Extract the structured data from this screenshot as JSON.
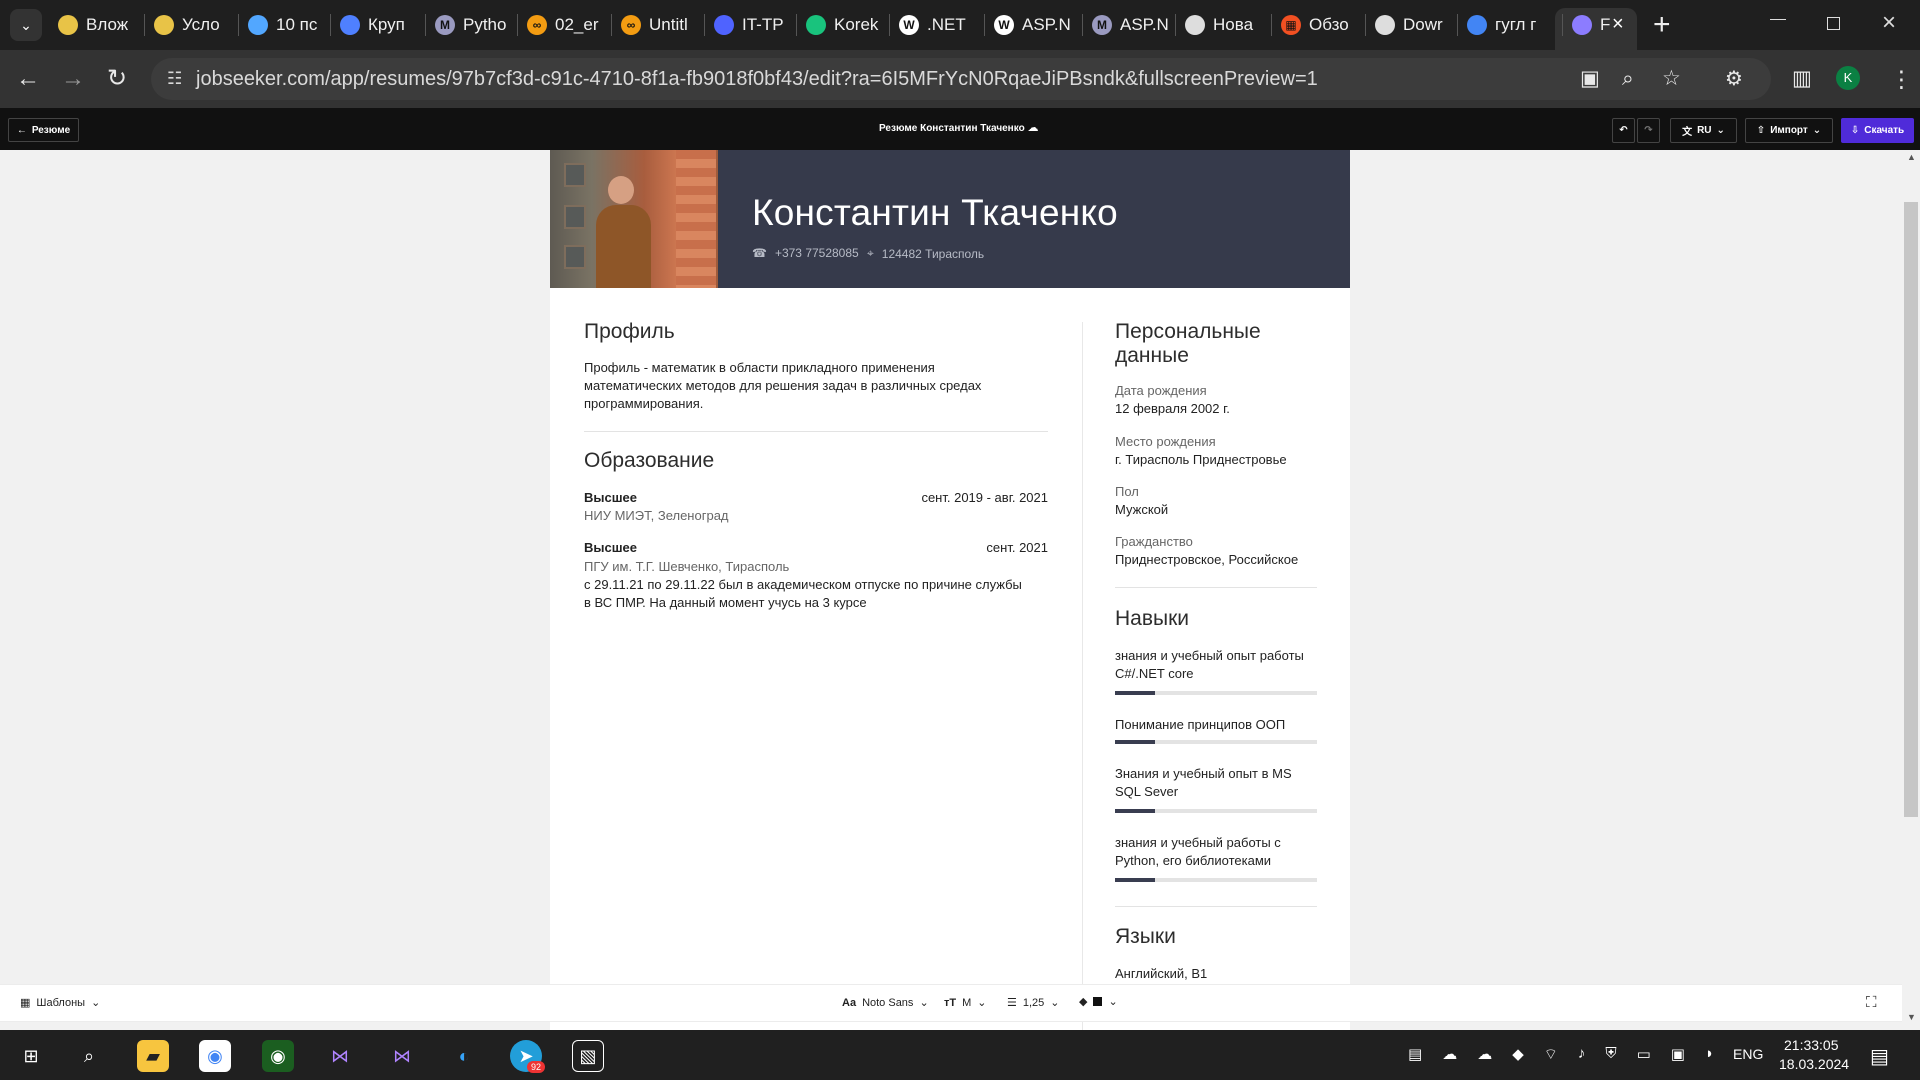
{
  "browser": {
    "tabs": [
      {
        "label": "Влож",
        "icon": "paint-icon",
        "color": "#e8c347"
      },
      {
        "label": "Усло",
        "icon": "paint-icon",
        "color": "#e8c347"
      },
      {
        "label": "10 пс",
        "icon": "sun-icon",
        "color": "#52a7ff"
      },
      {
        "label": "Круп",
        "icon": "cube-icon",
        "color": "#4f80ff"
      },
      {
        "label": "Pytho",
        "icon": "m-icon",
        "color": "#9a9ac0"
      },
      {
        "label": "02_er",
        "icon": "infinity-icon",
        "color": "#f39c12"
      },
      {
        "label": "Untitl",
        "icon": "infinity-icon",
        "color": "#f39c12"
      },
      {
        "label": "IT-TP",
        "icon": "star-icon",
        "color": "#4f63ff"
      },
      {
        "label": "Korek",
        "icon": "openai-icon",
        "color": "#19c37d"
      },
      {
        "label": ".NET",
        "icon": "w-icon",
        "color": "#ffffff"
      },
      {
        "label": "ASP.N",
        "icon": "w-icon",
        "color": "#ffffff"
      },
      {
        "label": "ASP.N",
        "icon": "m-icon",
        "color": "#9a9ac0"
      },
      {
        "label": "Нова",
        "icon": "chrome-icon",
        "color": "#dddddd"
      },
      {
        "label": "Обзо",
        "icon": "windows-icon",
        "color": "#f25022"
      },
      {
        "label": "Dowr",
        "icon": "globe-icon",
        "color": "#dddddd"
      },
      {
        "label": "гугл г",
        "icon": "google-icon",
        "color": "#4285f4"
      },
      {
        "label": "F",
        "icon": "jobseeker-icon",
        "color": "#8c7cff"
      }
    ],
    "address": "jobseeker.com/app/resumes/97b7cf3d-c91c-4710-8f1a-fb9018f0bf43/edit?ra=6I5MFrYcN0RqaeJiPBsndk&fullscreenPreview=1",
    "profile_initial": "K"
  },
  "app": {
    "back_label": "Резюме",
    "title": "Резюме Константин Ткаченко",
    "language": "RU",
    "import_label": "Импорт",
    "download_label": "Скачать"
  },
  "resume": {
    "name": "Константин Ткаченко",
    "phone": "+373 77528085",
    "location": "124482 Тирасполь",
    "profile": {
      "title": "Профиль",
      "text": "Профиль - математик в области прикладного применения математических методов для решения задач в различных средах программирования."
    },
    "education": {
      "title": "Образование",
      "items": [
        {
          "degree": "Высшее",
          "date": "сент. 2019 - авг. 2021",
          "school": "НИУ МИЭТ, Зеленоград",
          "note": ""
        },
        {
          "degree": "Высшее",
          "date": "сент. 2021",
          "school": "ПГУ им. Т.Г. Шевченко, Тирасполь",
          "note": "с 29.11.21 по 29.11.22 был в академическом отпуске по причине службы в ВС ПМР. На данный момент учусь на 3 курсе"
        }
      ]
    },
    "personal": {
      "title": "Персональные данные",
      "fields": [
        {
          "label": "Дата рождения",
          "value": "12 февраля 2002 г."
        },
        {
          "label": "Место рождения",
          "value": "г. Тирасполь Приднестровье"
        },
        {
          "label": "Пол",
          "value": "Мужской"
        },
        {
          "label": "Гражданство",
          "value": "Приднестровское, Российское"
        }
      ]
    },
    "skills": {
      "title": "Навыки",
      "items": [
        {
          "label": "знания и учебный опыт работы C#/.NET core",
          "level": 0.2
        },
        {
          "label": "Понимание принципов ООП",
          "level": 0.2
        },
        {
          "label": "Знания и учебный опыт в MS SQL Sever",
          "level": 0.2
        },
        {
          "label": "знания и учебный работы с Python, его библиотеками",
          "level": 0.2
        }
      ]
    },
    "languages": {
      "title": "Языки",
      "items": [
        {
          "label": "Английский, B1"
        }
      ]
    }
  },
  "toolbar": {
    "templates": "Шаблоны",
    "font": "Noto Sans",
    "size": "M",
    "line_height": "1,25"
  },
  "taskbar": {
    "language": "ENG",
    "time": "21:33:05",
    "date": "18.03.2024",
    "telegram_badge": "92"
  },
  "colors": {
    "accent": "#4f2bd9",
    "resume_header": "#363a4b",
    "active_tab": "#333333"
  }
}
